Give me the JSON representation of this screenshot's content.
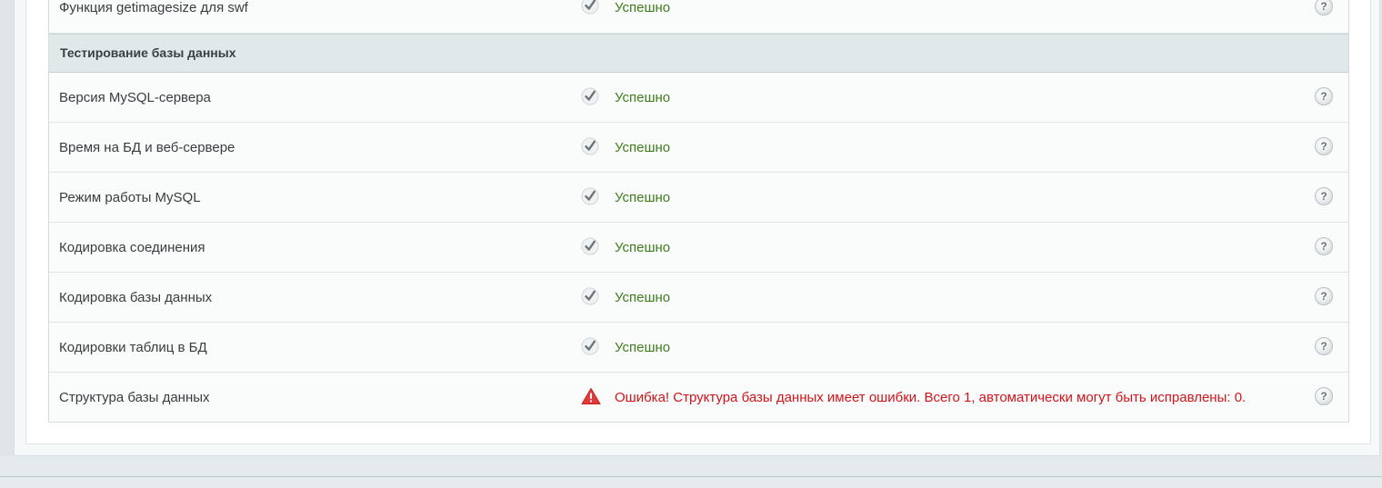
{
  "rows_before": [
    {
      "name": "Функция getimagesize для swf",
      "status": "ok",
      "status_text": "Успешно",
      "help": "?"
    }
  ],
  "section": {
    "title": "Тестирование базы данных"
  },
  "rows": [
    {
      "name": "Версия MySQL-сервера",
      "status": "ok",
      "status_text": "Успешно",
      "help": "?"
    },
    {
      "name": "Время на БД и веб-сервере",
      "status": "ok",
      "status_text": "Успешно",
      "help": "?"
    },
    {
      "name": "Режим работы MySQL",
      "status": "ok",
      "status_text": "Успешно",
      "help": "?"
    },
    {
      "name": "Кодировка соединения",
      "status": "ok",
      "status_text": "Успешно",
      "help": "?"
    },
    {
      "name": "Кодировка базы данных",
      "status": "ok",
      "status_text": "Успешно",
      "help": "?"
    },
    {
      "name": "Кодировки таблиц в БД",
      "status": "ok",
      "status_text": "Успешно",
      "help": "?"
    },
    {
      "name": "Структура базы данных",
      "status": "error",
      "status_text": "Ошибка! Структура базы данных имеет ошибки. Всего 1, автоматически могут быть исправлены: 0.",
      "help": "?"
    }
  ],
  "icons": {
    "ok": "checkmark-icon",
    "error": "warning-triangle-icon",
    "help": "help-icon"
  },
  "colors": {
    "ok_text": "#3f7d1c",
    "error_text": "#d0151a",
    "section_bg": "#e0e8ea"
  }
}
